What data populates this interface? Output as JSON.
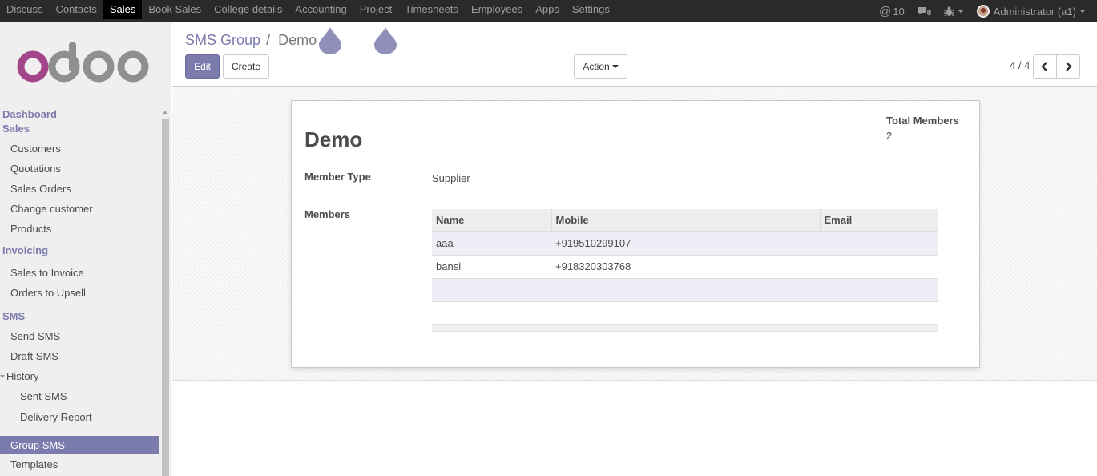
{
  "topnav": {
    "items": [
      "Discuss",
      "Contacts",
      "Sales",
      "Book Sales",
      "College details",
      "Accounting",
      "Project",
      "Timesheets",
      "Employees",
      "Apps",
      "Settings"
    ],
    "active": "Sales",
    "messages_count": "10",
    "user": "Administrator (a1)"
  },
  "sidebar": {
    "logo": "odoo",
    "dashboard": "Dashboard",
    "sales_title": "Sales",
    "sales_items": [
      "Customers",
      "Quotations",
      "Sales Orders",
      "Change customer",
      "Products"
    ],
    "invoicing_title": "Invoicing",
    "invoicing_items": [
      "Sales to Invoice",
      "Orders to Upsell"
    ],
    "sms_title": "SMS",
    "sms_items": [
      "Send SMS",
      "Draft SMS"
    ],
    "history_label": "History",
    "history_items": [
      "Sent SMS",
      "Delivery Report"
    ],
    "group_sms": "Group SMS",
    "templates": "Templates"
  },
  "control": {
    "breadcrumb_parent": "SMS Group",
    "breadcrumb_sep": "/",
    "breadcrumb_current": "Demo",
    "edit_label": "Edit",
    "create_label": "Create",
    "action_label": "Action",
    "pager": "4 / 4"
  },
  "form": {
    "title": "Demo",
    "total_members_label": "Total Members",
    "total_members_value": "2",
    "member_type_label": "Member Type",
    "member_type_value": "Supplier",
    "members_label": "Members",
    "table_headers": [
      "Name",
      "Mobile",
      "Email"
    ],
    "rows": [
      {
        "name": "aaa",
        "mobile": "+919510299107",
        "email": ""
      },
      {
        "name": "bansi",
        "mobile": "+918320303768",
        "email": ""
      }
    ]
  },
  "colors": {
    "accent": "#7c7bad",
    "topbar": "#2a2a2a"
  }
}
